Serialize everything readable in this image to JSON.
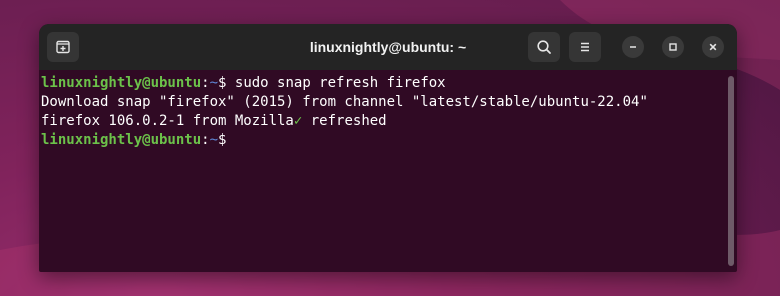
{
  "window": {
    "title": "linuxnightly@ubuntu: ~"
  },
  "titlebar": {
    "icons": [
      "new-tab-icon",
      "search-icon",
      "hamburger-menu-icon",
      "minimize-icon",
      "maximize-icon",
      "close-icon"
    ]
  },
  "terminal": {
    "prompt_user": "linuxnightly@ubuntu",
    "prompt_sep": ":",
    "prompt_path": "~",
    "prompt_symbol": "$",
    "lines": [
      {
        "command": " sudo snap refresh firefox"
      },
      {
        "output": "Download snap \"firefox\" (2015) from channel \"latest/stable/ubuntu-22.04\""
      },
      {
        "output_a": "firefox 106.0.2-1 from Mozilla",
        "check": "✓",
        "output_b": " refreshed"
      },
      {
        "command": ""
      }
    ]
  },
  "colors": {
    "terminal_bg": "#300a24",
    "titlebar_bg": "#242424",
    "prompt_user": "#6cc24a",
    "prompt_path": "#5f87d7"
  }
}
